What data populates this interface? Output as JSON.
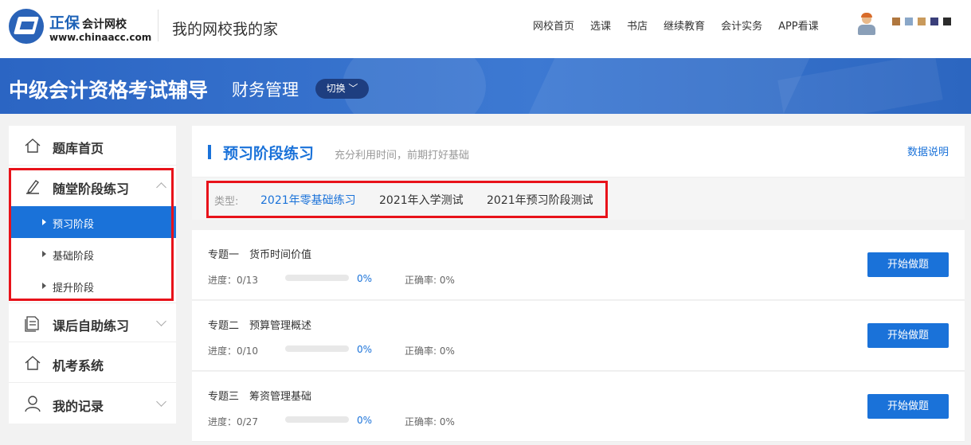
{
  "header": {
    "brand_name": "正保",
    "brand_sub": "会计网校",
    "brand_url": "www.chinaacc.com",
    "slogan": "我的网校我的家",
    "nav": [
      "网校首页",
      "选课",
      "书店",
      "继续教育",
      "会计实务",
      "APP看课"
    ],
    "swatch_colors": [
      "#b0773e",
      "#8aa7c8",
      "#c99a5c",
      "#3a3f7a",
      "#2b2b2b"
    ]
  },
  "banner": {
    "title": "中级会计资格考试辅导",
    "subject": "财务管理",
    "switch_label": "切换 ﹀"
  },
  "sidebar": {
    "items": [
      {
        "label": "题库首页",
        "icon": "home-icon"
      },
      {
        "label": "随堂阶段练习",
        "icon": "pen-icon",
        "expanded": true
      },
      {
        "label": "课后自助练习",
        "icon": "document-icon"
      },
      {
        "label": "机考系统",
        "icon": "home-icon"
      },
      {
        "label": "我的记录",
        "icon": "user-icon"
      }
    ],
    "sub_items": [
      {
        "label": "预习阶段",
        "active": true
      },
      {
        "label": "基础阶段",
        "active": false
      },
      {
        "label": "提升阶段",
        "active": false
      }
    ]
  },
  "main": {
    "title": "预习阶段练习",
    "description": "充分利用时间，前期打好基础",
    "data_link": "数据说明",
    "type_label": "类型:",
    "types": [
      {
        "label": "2021年零基础练习",
        "active": true
      },
      {
        "label": "2021年入学测试",
        "active": false
      },
      {
        "label": "2021年预习阶段测试",
        "active": false
      }
    ],
    "topics": [
      {
        "title": "专题一　货币时间价值",
        "progress": "进度：0/13",
        "progress_fraction": 0,
        "percent": "0%",
        "accuracy": "正确率: 0%",
        "button": "开始做题"
      },
      {
        "title": "专题二　预算管理概述",
        "progress": "进度：0/10",
        "progress_fraction": 0,
        "percent": "0%",
        "accuracy": "正确率: 0%",
        "button": "开始做题"
      },
      {
        "title": "专题三　筹资管理基础",
        "progress": "进度：0/27",
        "progress_fraction": 0,
        "percent": "0%",
        "accuracy": "正确率: 0%",
        "button": "开始做题"
      }
    ]
  }
}
